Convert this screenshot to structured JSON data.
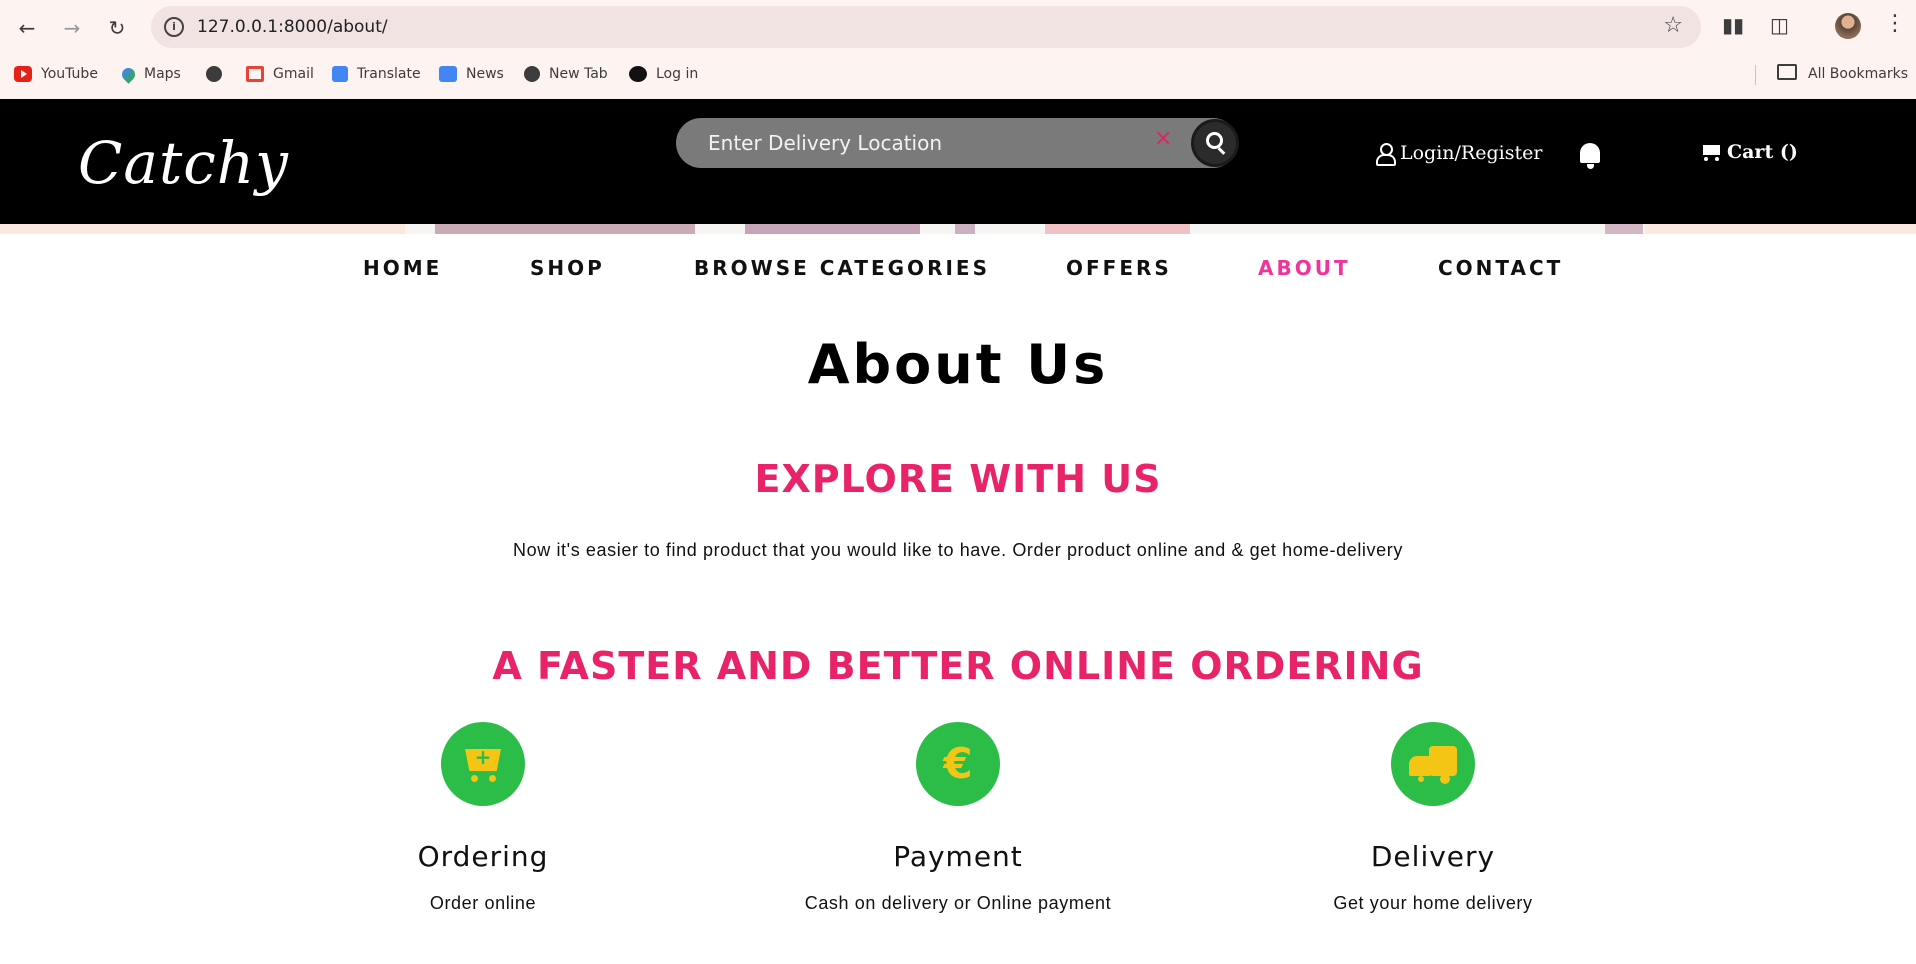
{
  "browser": {
    "url": "127.0.0.1:8000/about/",
    "bookmarks": [
      "YouTube",
      "Maps",
      "",
      "Gmail",
      "Translate",
      "News",
      "New Tab",
      "Log in"
    ],
    "all_bookmarks": "All Bookmarks"
  },
  "header": {
    "logo": "Catchy",
    "search_placeholder": "Enter Delivery Location",
    "clear_symbol": "×",
    "login": "Login/Register",
    "cart": "Cart ()"
  },
  "nav": [
    "HOME",
    "SHOP",
    "BROWSE CATEGORIES",
    "OFFERS",
    "ABOUT",
    "CONTACT"
  ],
  "nav_active": "ABOUT",
  "main": {
    "title": "About Us",
    "section1_title": "EXPLORE WITH US",
    "section1_text": "Now it's easier to find product that you would like to have. Order product online and & get home-delivery",
    "section2_title": "A FASTER AND BETTER ONLINE ORDERING",
    "features": [
      {
        "title": "Ordering",
        "text": "Order online",
        "icon": "cart-plus-icon"
      },
      {
        "title": "Payment",
        "text": "Cash on delivery or Online payment",
        "icon": "euro-icon"
      },
      {
        "title": "Delivery",
        "text": "Get your home delivery",
        "icon": "truck-icon"
      }
    ]
  },
  "colors": {
    "accent": "#e8236a",
    "nav_active": "#f0359a",
    "feature_circle": "#2bbd48",
    "feature_icon": "#f5c516",
    "header_bg": "#000000"
  }
}
